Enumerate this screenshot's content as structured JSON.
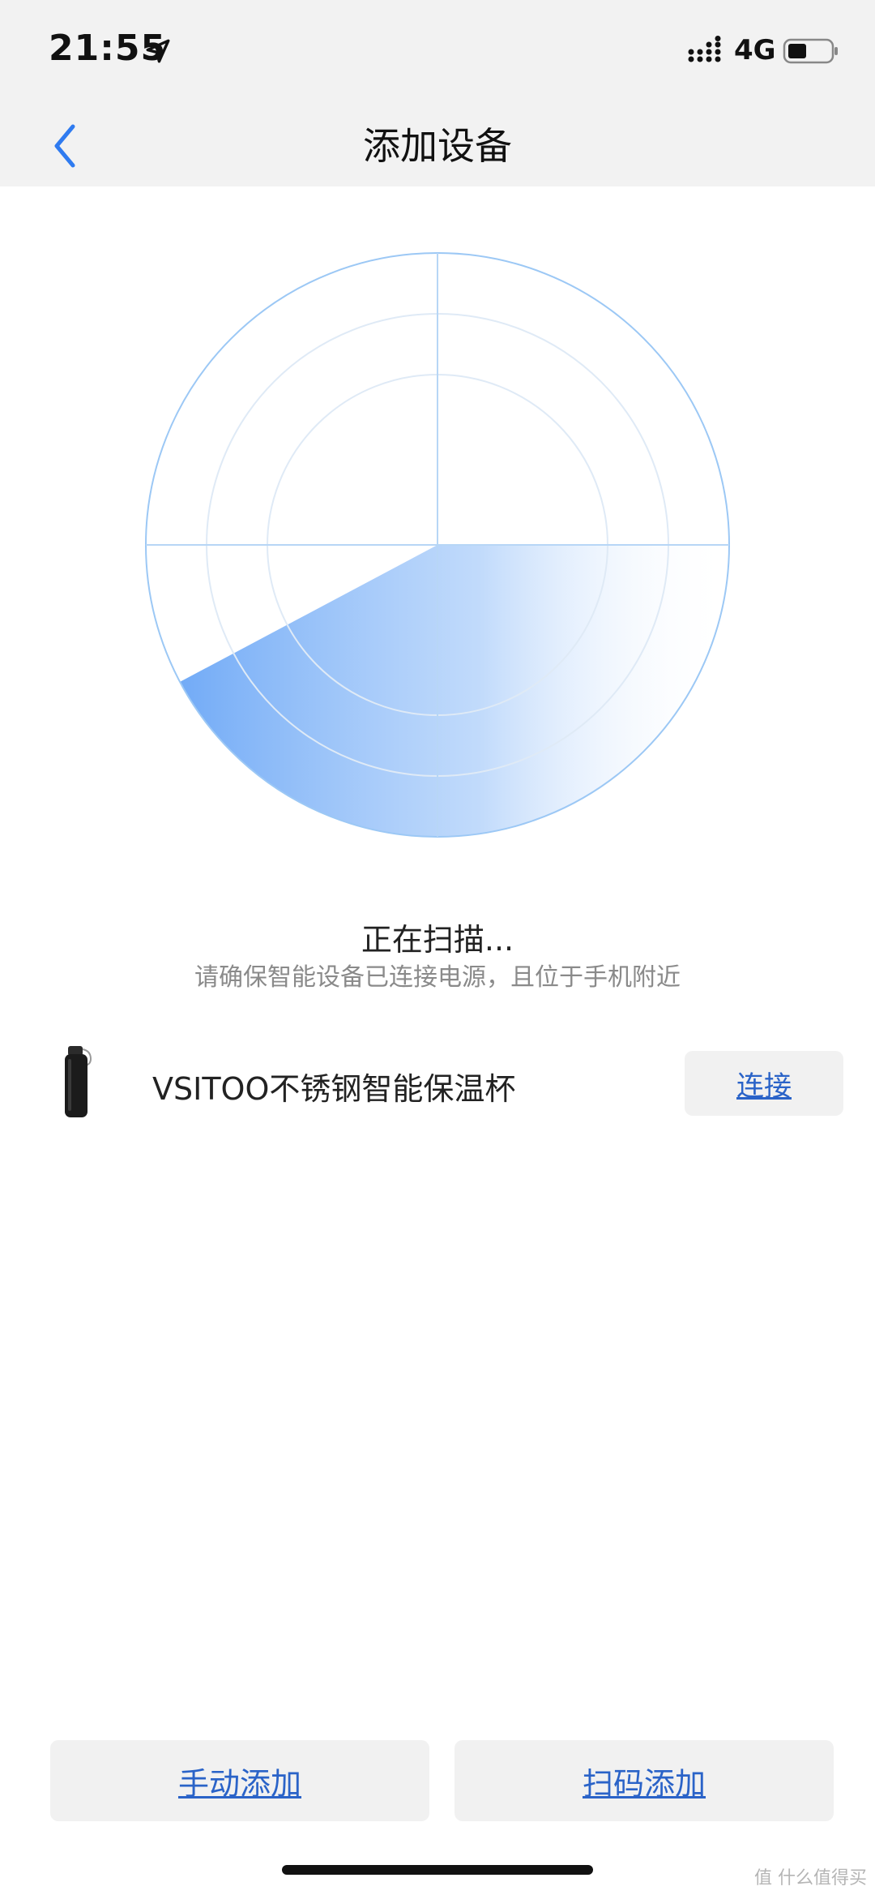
{
  "status_bar": {
    "time": "21:55",
    "network": "4G",
    "icons": [
      "location-arrow-icon",
      "signal-icon",
      "battery-icon"
    ]
  },
  "nav": {
    "title": "添加设备",
    "back_icon": "chevron-left-icon"
  },
  "scan": {
    "status_text": "正在扫描...",
    "hint_text": "请确保智能设备已连接电源，且位于手机附近"
  },
  "devices": [
    {
      "name": "VSITOO不锈钢智能保温杯",
      "action_label": "连接",
      "image_icon": "bottle-icon"
    }
  ],
  "bottom_buttons": {
    "manual_label": "手动添加",
    "scan_label": "扫码添加"
  },
  "watermark": "值 什么值得买",
  "colors": {
    "accent": "#2a63c8",
    "radar_line": "#9cc8f5",
    "radar_fill": "#6aa6f6",
    "header_bg": "#f2f2f2"
  }
}
